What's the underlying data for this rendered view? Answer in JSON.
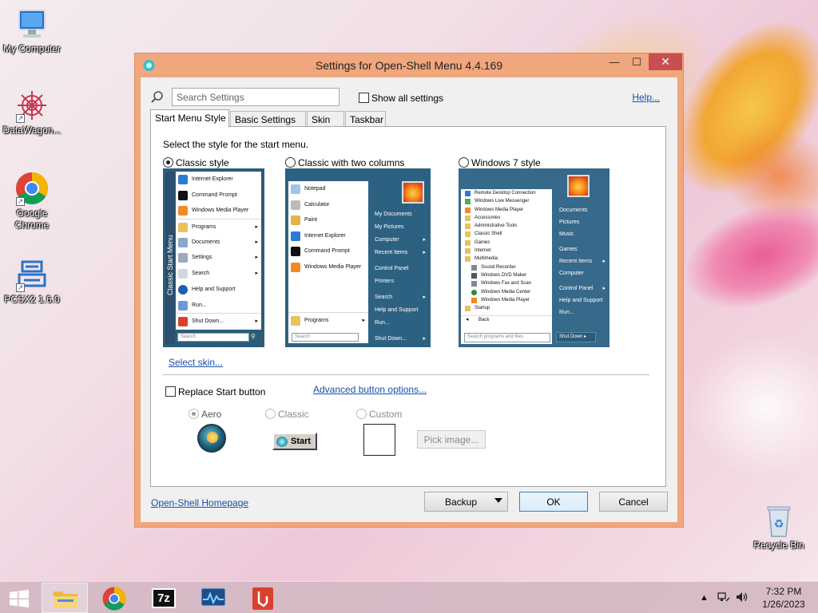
{
  "desktop": {
    "icons": [
      {
        "label": "My Computer"
      },
      {
        "label": "DataWagon..."
      },
      {
        "label": "Google Chrome"
      },
      {
        "label": "PCSX2 1.6.0"
      },
      {
        "label": "Recycle Bin"
      }
    ]
  },
  "window": {
    "title": "Settings for Open-Shell Menu 4.4.169",
    "min_glyph": "—",
    "max_glyph": "☐",
    "close_glyph": "✕"
  },
  "toolbar": {
    "search_placeholder": "Search Settings",
    "show_all_label": "Show all settings",
    "show_all_checked": false,
    "help_label": "Help..."
  },
  "tabs": [
    {
      "label": "Start Menu Style",
      "active": true
    },
    {
      "label": "Basic Settings",
      "active": false
    },
    {
      "label": "Skin",
      "active": false
    },
    {
      "label": "Taskbar",
      "active": false
    }
  ],
  "style_panel": {
    "prompt": "Select the style for the start menu.",
    "options": [
      {
        "label": "Classic style",
        "selected": true
      },
      {
        "label": "Classic with two columns",
        "selected": false
      },
      {
        "label": "Windows 7 style",
        "selected": false
      }
    ],
    "classic_preview": {
      "band_text": "Classic Start Menu",
      "items": [
        "Internet Explorer",
        "Command Prompt",
        "Windows Media Player",
        "Programs",
        "Documents",
        "Settings",
        "Search",
        "Help and Support",
        "Run...",
        "Shut Down..."
      ],
      "search_text": "Search"
    },
    "two_column_preview": {
      "left_items": [
        "Notepad",
        "Calculator",
        "Paint",
        "Internet Explorer",
        "Command Prompt",
        "Windows Media Player"
      ],
      "programs": "Programs",
      "search_text": "Search",
      "right_items": [
        "My Documents",
        "My Pictures",
        "Computer",
        "Recent Items",
        "Control Panel",
        "Printers",
        "Search",
        "Help and Support",
        "Run...",
        "Shut Down..."
      ]
    },
    "win7_preview": {
      "items": [
        "Remote Desktop Connection",
        "Windows Live Messenger",
        "Windows Media Player",
        "Accessories",
        "Administrative Tools",
        "Classic Shell",
        "Games",
        "Internet",
        "Multimedia",
        "Sound Recorder",
        "Windows DVD Maker",
        "Windows Fax and Scan",
        "Windows Media Center",
        "Windows Media Player",
        "Startup"
      ],
      "back": "Back",
      "search_text": "Search programs and files",
      "right_items": [
        "Documents",
        "Pictures",
        "Music",
        "Games",
        "Recent Items",
        "Computer",
        "Control Panel",
        "Help and Support",
        "Run..."
      ],
      "shutdown": "Shut Down"
    },
    "select_skin_link": "Select skin..."
  },
  "button_section": {
    "replace_label": "Replace Start button",
    "replace_checked": false,
    "advanced_link": "Advanced button options...",
    "styles": [
      {
        "label": "Aero",
        "selected": true
      },
      {
        "label": "Classic",
        "selected": false
      },
      {
        "label": "Custom",
        "selected": false
      }
    ],
    "classic_start_label": "Start",
    "pick_image_label": "Pick image..."
  },
  "footer": {
    "homepage_link": "Open-Shell Homepage",
    "backup_label": "Backup",
    "ok_label": "OK",
    "cancel_label": "Cancel"
  },
  "taskbar": {
    "start_icon": "windows-logo-icon",
    "apps": [
      "file-explorer-icon",
      "chrome-icon",
      "7zip-icon",
      "activity-monitor-icon",
      "pdf-app-icon"
    ],
    "clock_time": "7:32 PM",
    "clock_date": "1/26/2023"
  },
  "colors": {
    "accent": "#f0a77d",
    "close_button": "#c74f4f",
    "link": "#1a4fa6"
  }
}
